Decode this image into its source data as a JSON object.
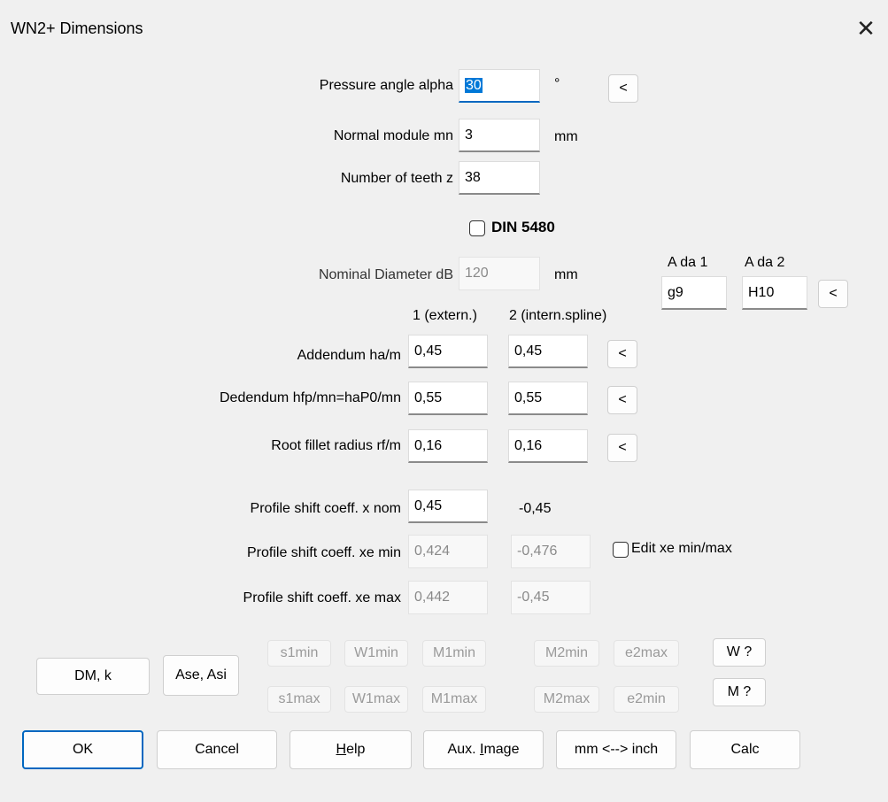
{
  "window": {
    "title": "WN2+  Dimensions",
    "close_glyph": "✕"
  },
  "pressure_angle": {
    "label": "Pressure angle alpha",
    "value": "30",
    "unit": "°",
    "button": "<"
  },
  "normal_module": {
    "label": "Normal module mn",
    "value": "3",
    "unit": "mm"
  },
  "teeth": {
    "label": "Number of teeth z",
    "value": "38"
  },
  "din": {
    "label": "DIN 5480",
    "checked": false
  },
  "nominal_diameter": {
    "label": "Nominal Diameter dB",
    "value": "120",
    "unit": "mm"
  },
  "tolerance": {
    "header1": "A da 1",
    "header2": "A da 2",
    "value1": "g9",
    "value2": "H10",
    "button": "<"
  },
  "columns": {
    "col1": "1 (extern.)",
    "col2": "2 (intern.spline)"
  },
  "addendum": {
    "label": "Addendum ha/m",
    "value1": "0,45",
    "value2": "0,45",
    "button": "<"
  },
  "dedendum": {
    "label": "Dedendum hfp/mn=haP0/mn",
    "value1": "0,55",
    "value2": "0,55",
    "button": "<"
  },
  "root_fillet": {
    "label": "Root fillet radius rf/m",
    "value1": "0,16",
    "value2": "0,16",
    "button": "<"
  },
  "profile_shift_nom": {
    "label": "Profile shift coeff. x nom",
    "value1": "0,45",
    "value2": "-0,45"
  },
  "profile_shift_min": {
    "label": "Profile shift coeff. xe min",
    "value1": "0,424",
    "value2": "-0,476"
  },
  "profile_shift_max": {
    "label": "Profile shift coeff. xe max",
    "value1": "0,442",
    "value2": "-0,45"
  },
  "edit_xe": {
    "label": "Edit xe min/max",
    "checked": false
  },
  "mid_buttons": {
    "dm_k": "DM, k",
    "ase_asi": "Ase, Asi",
    "s1min": "s1min",
    "w1min": "W1min",
    "m1min": "M1min",
    "m2min": "M2min",
    "e2max": "e2max",
    "s1max": "s1max",
    "w1max": "W1max",
    "m1max": "M1max",
    "m2max": "M2max",
    "e2min": "e2min",
    "w_q": "W ?",
    "m_q": "M ?"
  },
  "bottom_buttons": {
    "ok": "OK",
    "cancel": "Cancel",
    "help_u": "H",
    "help_rest": "elp",
    "aux_pre": "Aux. ",
    "aux_u": "I",
    "aux_rest": "mage",
    "units": "mm <--> inch",
    "calc": "Calc"
  }
}
